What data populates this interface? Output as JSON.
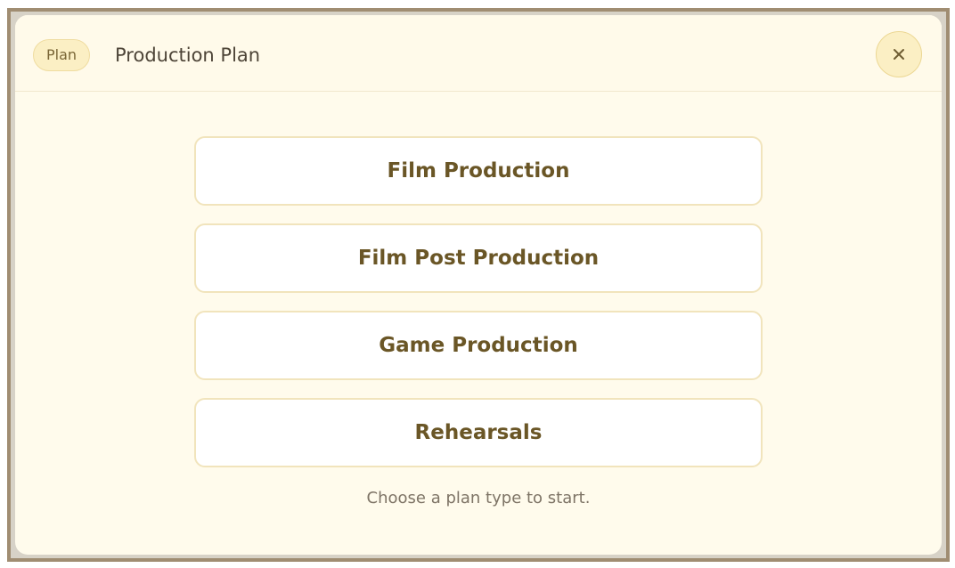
{
  "header": {
    "badge": "Plan",
    "title": "Production Plan",
    "close_icon": "close-icon"
  },
  "options": [
    {
      "label": "Film Production"
    },
    {
      "label": "Film Post Production"
    },
    {
      "label": "Game Production"
    },
    {
      "label": "Rehearsals"
    }
  ],
  "hint": "Choose a plan type to start.",
  "colors": {
    "background": "#fffbec",
    "accent": "#fbefc4",
    "option_text": "#6a5626",
    "frame": "#a08d72"
  }
}
